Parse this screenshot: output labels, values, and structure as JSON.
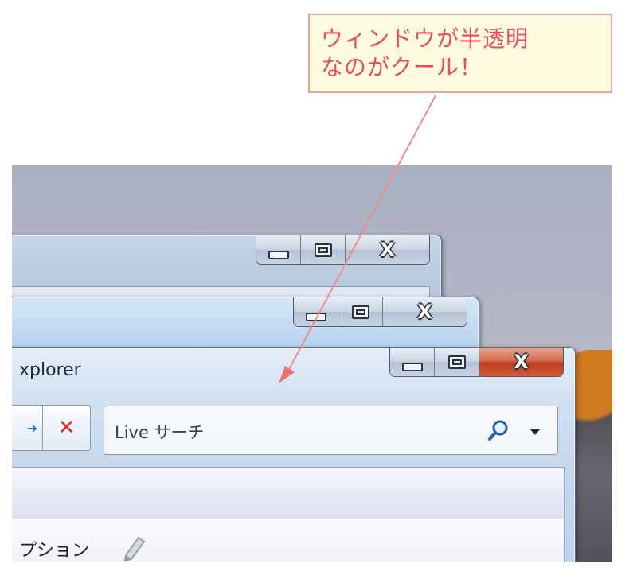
{
  "callout": {
    "line1": "ウィンドウが半透明",
    "line2": "なのがクール！"
  },
  "windows": {
    "back": {
      "caption_buttons": [
        "minimize-icon",
        "maximize-icon",
        "close-icon"
      ]
    },
    "middle": {
      "caption_buttons": [
        "minimize-icon",
        "maximize-icon",
        "close-icon"
      ]
    },
    "front": {
      "title": "xplorer",
      "caption_buttons": [
        "minimize-icon",
        "maximize-icon",
        "close-icon"
      ],
      "close_color": "#c4462a",
      "nav": {
        "forward_icon": "forward-arrow-icon",
        "stop_icon": "stop-x-icon"
      },
      "search": {
        "placeholder": "Live サーチ",
        "search_icon": "magnifier-icon",
        "dropdown_icon": "chevron-down-icon"
      },
      "menu_item": "プション",
      "menu_icon": "pencil-icon"
    }
  },
  "colors": {
    "callout_text": "#ea4c5c",
    "callout_border": "#f29c9c",
    "callout_bg": "#fffbe0",
    "arrow": "#f08c8c"
  }
}
